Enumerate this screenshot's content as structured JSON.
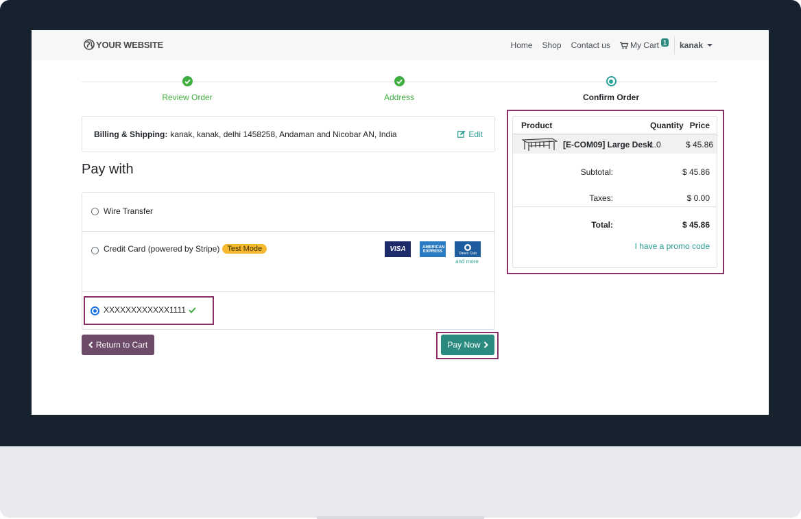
{
  "header": {
    "logo_text": "YOUR WEBSITE",
    "nav": {
      "home": "Home",
      "shop": "Shop",
      "contact": "Contact us",
      "cart": "My Cart",
      "cart_count": "1",
      "user": "kanak"
    }
  },
  "wizard": {
    "steps": [
      {
        "label": "Review Order",
        "state": "done"
      },
      {
        "label": "Address",
        "state": "done"
      },
      {
        "label": "Confirm Order",
        "state": "current"
      }
    ]
  },
  "billing": {
    "label": "Billing & Shipping:",
    "address": "kanak, kanak, delhi 1458258, Andaman and Nicobar AN, India",
    "edit": "Edit"
  },
  "payment": {
    "title": "Pay with",
    "options": {
      "wire": "Wire Transfer",
      "card": "Credit Card (powered by Stripe)",
      "card_badge": "Test Mode",
      "token": "XXXXXXXXXXXX1111"
    },
    "card_brands": {
      "visa": "VISA",
      "amex": "AMERICAN EXPRESS",
      "diners": "Diners Club"
    },
    "and_more": "and more"
  },
  "buttons": {
    "return": "Return to Cart",
    "pay": "Pay Now"
  },
  "summary": {
    "headers": {
      "product": "Product",
      "quantity": "Quantity",
      "price": "Price"
    },
    "item": {
      "name": "[E-COM09] Large Desk",
      "qty": "1.0",
      "price": "$ 45.86"
    },
    "subtotal_label": "Subtotal:",
    "subtotal": "$ 45.86",
    "taxes_label": "Taxes:",
    "taxes": "$ 0.00",
    "total_label": "Total:",
    "total": "$ 45.86",
    "promo": "I have a promo code"
  },
  "colors": {
    "accent": "#2a8a7f",
    "done": "#3fae3f",
    "return_button": "#6e4b68",
    "highlight": "#8a2f66"
  }
}
